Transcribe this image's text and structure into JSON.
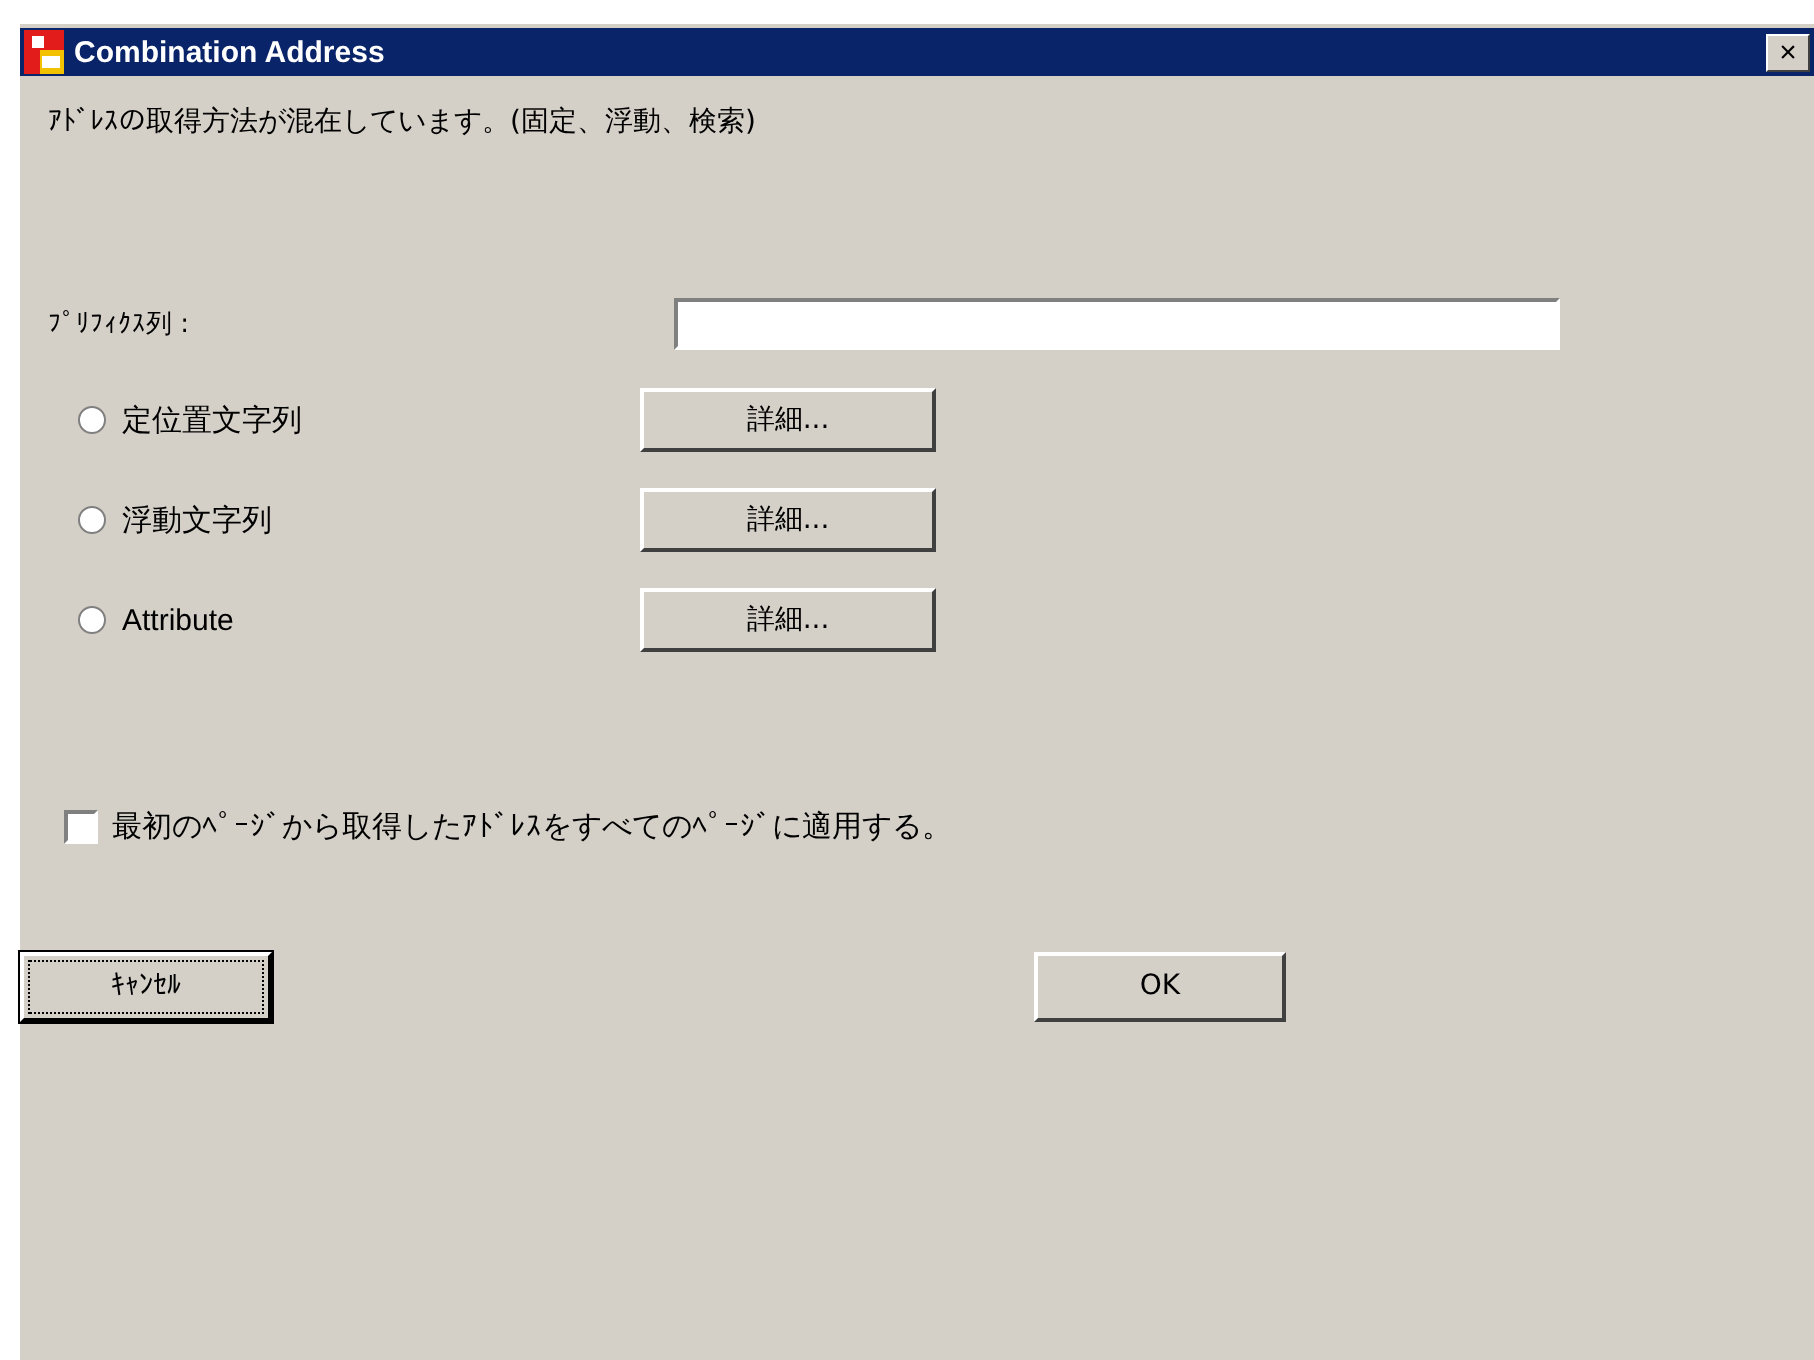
{
  "window": {
    "title": "Combination Address",
    "close": "×"
  },
  "message": "ｱﾄﾞﾚｽの取得方法が混在しています。(固定、浮動、検索)",
  "prefix": {
    "label": "ﾌﾟﾘﾌｨｸｽ列 :"
  },
  "options": [
    {
      "label": "定位置文字列",
      "selected": false,
      "button": "詳細..."
    },
    {
      "label": "浮動文字列",
      "selected": false,
      "button": "詳細..."
    },
    {
      "label": "Attribute",
      "selected": false,
      "button": "詳細..."
    }
  ],
  "apply_all": {
    "label": "最初のﾍﾟｰｼﾞから取得したｱﾄﾞﾚｽをすべてのﾍﾟｰｼﾞに適用する。",
    "checked": false
  },
  "buttons": [
    {
      "label": "ｷｬﾝｾﾙ",
      "focused": true
    },
    {
      "label": "OK",
      "focused": false
    }
  ]
}
